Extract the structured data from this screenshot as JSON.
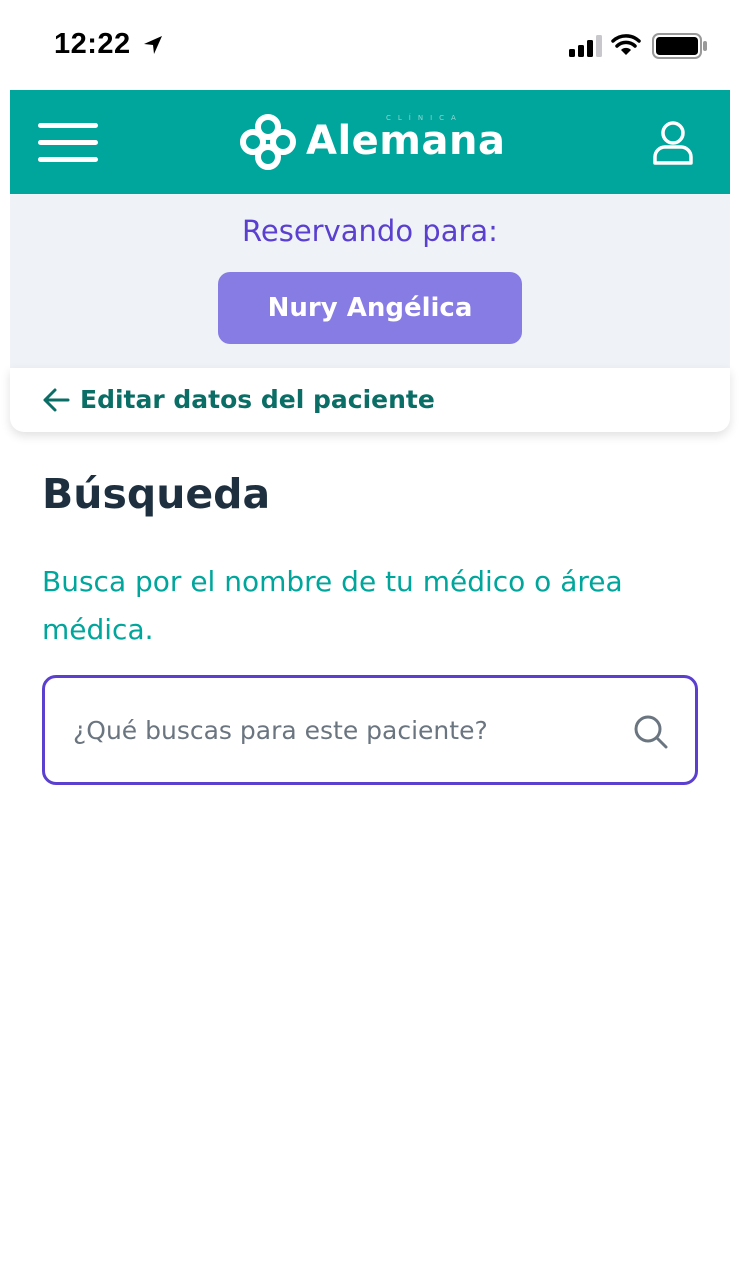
{
  "status_bar": {
    "time": "12:22"
  },
  "header": {
    "brand": "Alemana",
    "brand_sub": "CLÍNICA",
    "accent_color": "#00a69c"
  },
  "reserving": {
    "label": "Reservando para:",
    "patient_name": "Nury Angélica",
    "button_color": "#877be4"
  },
  "edit_link": {
    "label": "Editar datos del paciente"
  },
  "main": {
    "title": "Búsqueda",
    "subtitle": "Busca por el nombre de tu médico o área médica.",
    "search": {
      "placeholder": "¿Qué buscas para este paciente?",
      "value": "",
      "border_color": "#5b40d0"
    }
  },
  "icons": [
    "location-arrow-icon",
    "signal-icon",
    "wifi-icon",
    "battery-icon",
    "menu-icon",
    "alemana-logo-icon",
    "user-icon",
    "arrow-left-icon",
    "search-icon"
  ]
}
